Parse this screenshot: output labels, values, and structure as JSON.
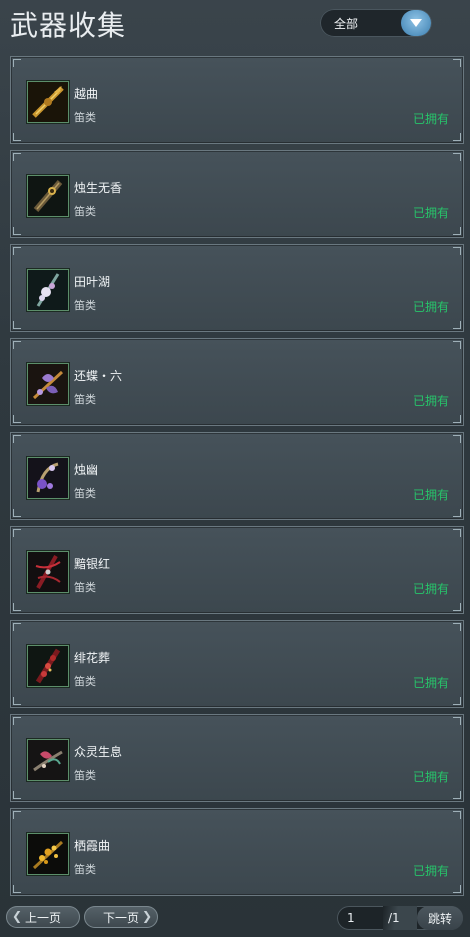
{
  "header": {
    "title": "武器收集"
  },
  "filter": {
    "selected": "全部"
  },
  "items": [
    {
      "name": "越曲",
      "type": "笛类",
      "status": "已拥有",
      "icon": "golden-flute-icon"
    },
    {
      "name": "烛生无香",
      "type": "笛类",
      "status": "已拥有",
      "icon": "ornate-flute-icon"
    },
    {
      "name": "田叶湖",
      "type": "笛类",
      "status": "已拥有",
      "icon": "lotus-flute-icon"
    },
    {
      "name": "还蝶・六",
      "type": "笛类",
      "status": "已拥有",
      "icon": "butterfly-flute-icon"
    },
    {
      "name": "烛幽",
      "type": "笛类",
      "status": "已拥有",
      "icon": "purple-flower-flute-icon"
    },
    {
      "name": "黯银红",
      "type": "笛类",
      "status": "已拥有",
      "icon": "red-flute-icon"
    },
    {
      "name": "绯花葬",
      "type": "笛类",
      "status": "已拥有",
      "icon": "crimson-flute-icon"
    },
    {
      "name": "众灵生息",
      "type": "笛类",
      "status": "已拥有",
      "icon": "spirit-flute-icon"
    },
    {
      "name": "栖霞曲",
      "type": "笛类",
      "status": "已拥有",
      "icon": "gold-blossom-flute-icon"
    }
  ],
  "pagination": {
    "prev_label": "上一页",
    "next_label": "下一页",
    "current_page": "1",
    "total_pages": "/1",
    "jump_label": "跳转"
  },
  "colors": {
    "owned": "#27c46a",
    "accent": "#5aa3d6"
  }
}
